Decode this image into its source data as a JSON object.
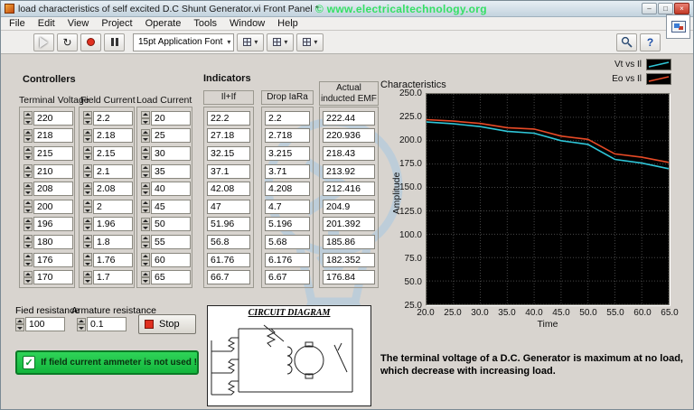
{
  "window": {
    "title": "load characteristics of self excited D.C Shunt Generator.vi Front Panel *",
    "watermark": "© www.electricaltechnology.org"
  },
  "menu": {
    "items": [
      "File",
      "Edit",
      "View",
      "Project",
      "Operate",
      "Tools",
      "Window",
      "Help"
    ]
  },
  "toolbar": {
    "font_selector": "15pt Application Font"
  },
  "icons": {
    "dropdown_arrow": "▾",
    "help": "?",
    "check": "✓",
    "run_continuous": "↻",
    "minimize": "–",
    "maximize": "□",
    "close": "×"
  },
  "colors": {
    "note_button_green": "#12b53c",
    "stop_red": "#e03020",
    "watermark_green": "#35e065"
  },
  "controllers": {
    "section_label": "Controllers",
    "columns": [
      {
        "label": "Terminal Voltage",
        "values": [
          "220",
          "218",
          "215",
          "210",
          "208",
          "200",
          "196",
          "180",
          "176",
          "170"
        ]
      },
      {
        "label": "Field Current",
        "values": [
          "2.2",
          "2.18",
          "2.15",
          "2.1",
          "2.08",
          "2",
          "1.96",
          "1.8",
          "1.76",
          "1.7"
        ]
      },
      {
        "label": "Load Current",
        "values": [
          "20",
          "25",
          "30",
          "35",
          "40",
          "45",
          "50",
          "55",
          "60",
          "65"
        ]
      }
    ],
    "field_resistance": {
      "label": "Fied resistance",
      "value": "100"
    },
    "armature_resistance": {
      "label": "Armature resistance",
      "value": "0.1"
    },
    "stop_button": "Stop",
    "note_button": "If field current ammeter is not used !"
  },
  "indicators": {
    "section_label": "Indicators",
    "columns": [
      {
        "label": "Il+If",
        "values": [
          "22.2",
          "27.18",
          "32.15",
          "37.1",
          "42.08",
          "47",
          "51.96",
          "56.8",
          "61.76",
          "66.7"
        ]
      },
      {
        "label": "Drop IaRa",
        "values": [
          "2.2",
          "2.718",
          "3.215",
          "3.71",
          "4.208",
          "4.7",
          "5.196",
          "5.68",
          "6.176",
          "6.67"
        ]
      },
      {
        "label": "Actual inducted EMF",
        "values": [
          "222.44",
          "220.936",
          "218.43",
          "213.92",
          "212.416",
          "204.9",
          "201.392",
          "185.86",
          "182.352",
          "176.84"
        ]
      }
    ],
    "circuit_title": "CIRCUIT DIAGRAM"
  },
  "chart": {
    "title": "Characteristics",
    "caption": "The terminal voltage of a D.C. Generator is maximum at no load, which decrease with increasing load."
  },
  "chart_data": {
    "type": "line",
    "x": [
      20,
      25,
      30,
      35,
      40,
      45,
      50,
      55,
      60,
      65
    ],
    "series": [
      {
        "name": "Vt vs Il",
        "color": "#2fc6d8",
        "values": [
          220,
          218,
          215,
          210,
          208,
          200,
          196,
          180,
          176,
          170
        ]
      },
      {
        "name": "Eo vs Il",
        "color": "#e84a26",
        "values": [
          222.44,
          220.936,
          218.43,
          213.92,
          212.416,
          204.9,
          201.392,
          185.86,
          182.352,
          176.84
        ]
      }
    ],
    "title": "Characteristics",
    "xlabel": "Time",
    "ylabel": "Amplitude",
    "xlim": [
      20,
      65
    ],
    "ylim": [
      25,
      250
    ],
    "xticks": [
      20,
      25,
      30,
      35,
      40,
      45,
      50,
      55,
      60,
      65
    ],
    "yticks": [
      250,
      225,
      200,
      175,
      150,
      125,
      100,
      75,
      50,
      25
    ],
    "grid": true,
    "plot_bg": "#000000",
    "legend_position": "top-right"
  }
}
